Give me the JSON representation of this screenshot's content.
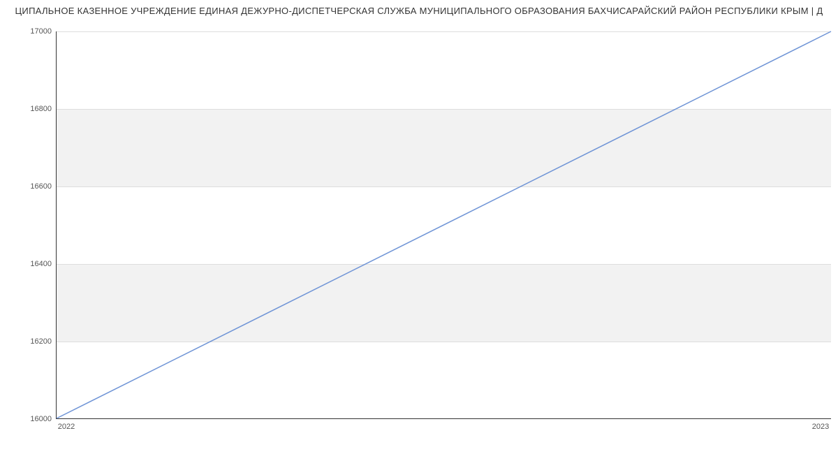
{
  "chart_data": {
    "type": "line",
    "title": "ЦИПАЛЬНОЕ КАЗЕННОЕ УЧРЕЖДЕНИЕ ЕДИНАЯ ДЕЖУРНО-ДИСПЕТЧЕРСКАЯ СЛУЖБА МУНИЦИПАЛЬНОГО ОБРАЗОВАНИЯ БАХЧИСАРАЙСКИЙ РАЙОН РЕСПУБЛИКИ КРЫМ | Д",
    "x": [
      "2022",
      "2023"
    ],
    "values": [
      16000,
      17000
    ],
    "xlabel": "",
    "ylabel": "",
    "xlim": [
      "2022",
      "2023"
    ],
    "ylim": [
      16000,
      17000
    ],
    "y_ticks": [
      16000,
      16200,
      16400,
      16600,
      16800,
      17000
    ],
    "x_ticks": [
      "2022",
      "2023"
    ],
    "line_color": "#6f94d6",
    "band_color": "#f2f2f2"
  }
}
